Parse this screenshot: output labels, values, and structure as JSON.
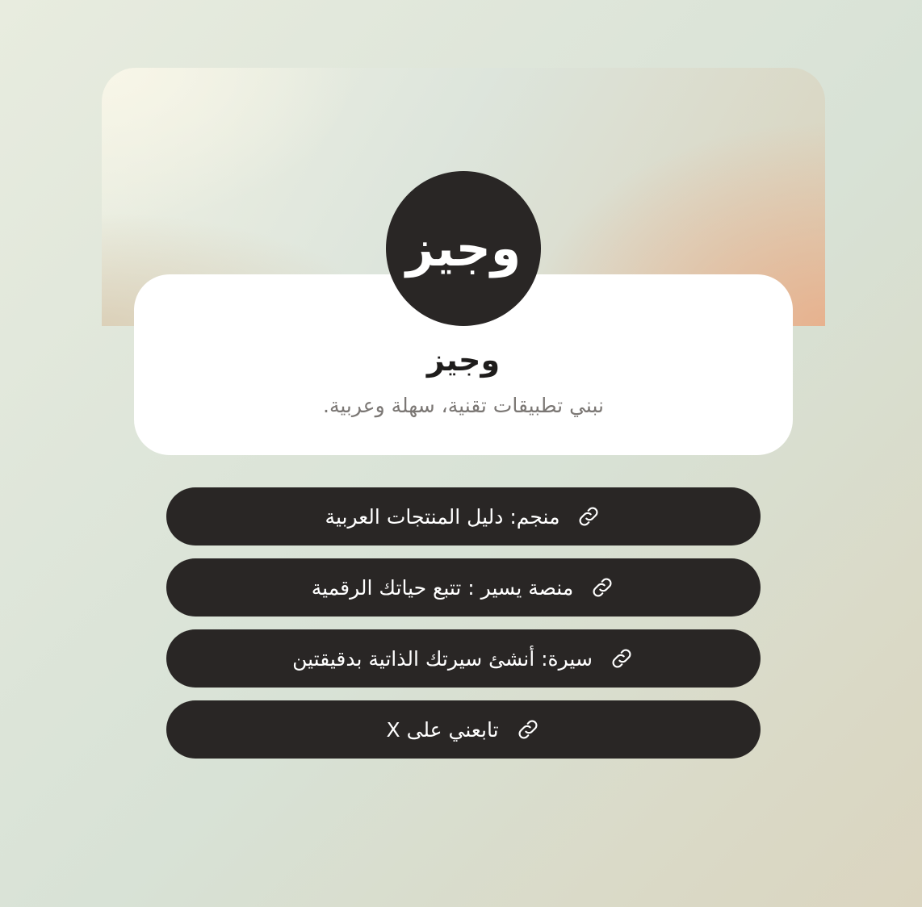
{
  "profile": {
    "logo_text": "وجيز",
    "name": "وجيز",
    "bio": "نبني تطبيقات تقنية، سهلة وعربية."
  },
  "links": [
    {
      "label": "منجم: دليل المنتجات العربية",
      "icon": "link-icon"
    },
    {
      "label": "منصة يسير : تتبع حياتك الرقمية",
      "icon": "link-icon"
    },
    {
      "label": "سيرة: أنشئ سيرتك الذاتية بدقيقتين",
      "icon": "link-icon"
    },
    {
      "label": "تابعني على X",
      "icon": "link-icon"
    }
  ],
  "colors": {
    "button_bg": "#292625",
    "avatar_bg": "#292625",
    "card_bg": "#ffffff",
    "accent_peach": "#e8b08c"
  }
}
